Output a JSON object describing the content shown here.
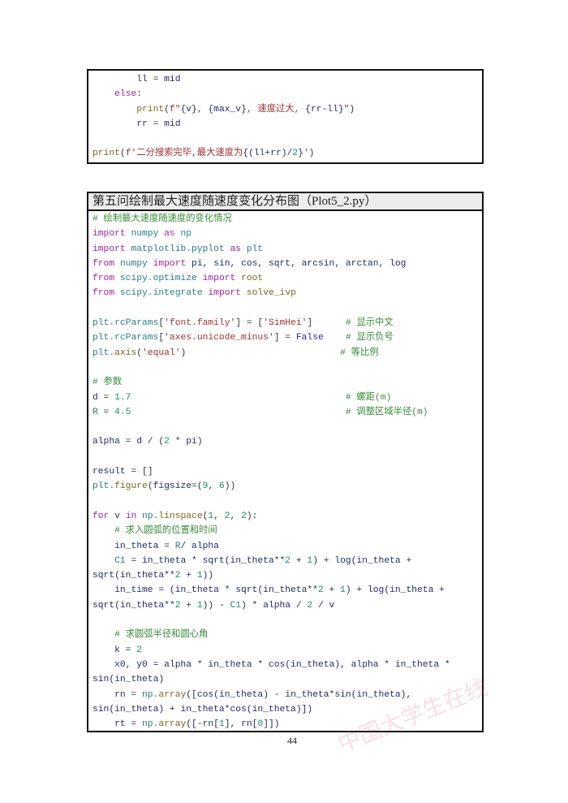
{
  "box1": {
    "lines": [
      [
        [
          "p",
          "        "
        ],
        [
          "v",
          "ll"
        ],
        [
          "p",
          " = "
        ],
        [
          "v",
          "mid"
        ]
      ],
      [
        [
          "p",
          "    "
        ],
        [
          "k",
          "else"
        ],
        [
          "p",
          ":"
        ]
      ],
      [
        [
          "p",
          "        "
        ],
        [
          "f",
          "print"
        ],
        [
          "p",
          "("
        ],
        [
          "s",
          "f\""
        ],
        [
          "v",
          "{v}"
        ],
        [
          "s",
          ", "
        ],
        [
          "v",
          "{max_v}"
        ],
        [
          "s",
          ", 速度过大, "
        ],
        [
          "v",
          "{rr-ll}"
        ],
        [
          "s",
          "\""
        ],
        [
          "p",
          ")"
        ]
      ],
      [
        [
          "p",
          "        "
        ],
        [
          "v",
          "rr"
        ],
        [
          "p",
          " = "
        ],
        [
          "v",
          "mid"
        ]
      ],
      [],
      [
        [
          "f",
          "print"
        ],
        [
          "p",
          "("
        ],
        [
          "s",
          "f'二分搜索完毕,最大速度为"
        ],
        [
          "v",
          "{(ll+rr)/"
        ],
        [
          "n",
          "2"
        ],
        [
          "v",
          "}"
        ],
        [
          "s",
          "'"
        ],
        [
          "p",
          ")"
        ]
      ]
    ]
  },
  "box2": {
    "title": "第五问绘制最大速度随速度变化分布图（Plot5_2.py）",
    "lines": [
      [
        [
          "c",
          "# 绘制最大速度随速度的变化情况"
        ]
      ],
      [
        [
          "k",
          "import"
        ],
        [
          "p",
          " "
        ],
        [
          "m",
          "numpy"
        ],
        [
          "p",
          " "
        ],
        [
          "k",
          "as"
        ],
        [
          "p",
          " "
        ],
        [
          "m",
          "np"
        ]
      ],
      [
        [
          "k",
          "import"
        ],
        [
          "p",
          " "
        ],
        [
          "m",
          "matplotlib.pyplot"
        ],
        [
          "p",
          " "
        ],
        [
          "k",
          "as"
        ],
        [
          "p",
          " "
        ],
        [
          "m",
          "plt"
        ]
      ],
      [
        [
          "k",
          "from"
        ],
        [
          "p",
          " "
        ],
        [
          "m",
          "numpy"
        ],
        [
          "p",
          " "
        ],
        [
          "k",
          "import"
        ],
        [
          "v",
          " pi, sin, cos, sqrt, arcsin, arctan, log"
        ]
      ],
      [
        [
          "k",
          "from"
        ],
        [
          "p",
          " "
        ],
        [
          "m",
          "scipy.optimize"
        ],
        [
          "p",
          " "
        ],
        [
          "k",
          "import"
        ],
        [
          "p",
          " "
        ],
        [
          "f",
          "root"
        ]
      ],
      [
        [
          "k",
          "from"
        ],
        [
          "p",
          " "
        ],
        [
          "m",
          "scipy.integrate"
        ],
        [
          "p",
          " "
        ],
        [
          "k",
          "import"
        ],
        [
          "p",
          " "
        ],
        [
          "f",
          "solve_ivp"
        ]
      ],
      [],
      [
        [
          "m",
          "plt.rcParams"
        ],
        [
          "p",
          "["
        ],
        [
          "s",
          "'font.family'"
        ],
        [
          "p",
          "] = ["
        ],
        [
          "s",
          "'SimHei'"
        ],
        [
          "p",
          "]      "
        ],
        [
          "c",
          "# 显示中文"
        ]
      ],
      [
        [
          "m",
          "plt.rcParams"
        ],
        [
          "p",
          "["
        ],
        [
          "s",
          "'axes.unicode_minus'"
        ],
        [
          "p",
          "] = "
        ],
        [
          "b",
          "False"
        ],
        [
          "p",
          "    "
        ],
        [
          "c",
          "# 显示负号"
        ]
      ],
      [
        [
          "m",
          "plt."
        ],
        [
          "f",
          "axis"
        ],
        [
          "p",
          "("
        ],
        [
          "s",
          "'equal'"
        ],
        [
          "p",
          ")                            "
        ],
        [
          "c",
          "# 等比例"
        ]
      ],
      [],
      [
        [
          "c",
          "# 参数"
        ]
      ],
      [
        [
          "v",
          "d"
        ],
        [
          "p",
          " = "
        ],
        [
          "n",
          "1.7"
        ],
        [
          "p",
          "                                       "
        ],
        [
          "c",
          "# 螺距(m)"
        ]
      ],
      [
        [
          "m",
          "R"
        ],
        [
          "p",
          " = "
        ],
        [
          "n",
          "4.5"
        ],
        [
          "p",
          "                                       "
        ],
        [
          "c",
          "# 调整区域半径(m)"
        ]
      ],
      [],
      [
        [
          "v",
          "alpha"
        ],
        [
          "p",
          " = "
        ],
        [
          "v",
          "d"
        ],
        [
          "p",
          " / ("
        ],
        [
          "n",
          "2"
        ],
        [
          "p",
          " * "
        ],
        [
          "v",
          "pi"
        ],
        [
          "p",
          ")"
        ]
      ],
      [],
      [
        [
          "v",
          "result"
        ],
        [
          "p",
          " = []"
        ]
      ],
      [
        [
          "m",
          "plt."
        ],
        [
          "f",
          "figure"
        ],
        [
          "p",
          "("
        ],
        [
          "v",
          "figsize"
        ],
        [
          "p",
          "=("
        ],
        [
          "n",
          "9"
        ],
        [
          "p",
          ", "
        ],
        [
          "n",
          "6"
        ],
        [
          "p",
          "))"
        ]
      ],
      [],
      [
        [
          "k",
          "for"
        ],
        [
          "v",
          " v "
        ],
        [
          "k",
          "in"
        ],
        [
          "p",
          " "
        ],
        [
          "m",
          "np."
        ],
        [
          "f",
          "linspace"
        ],
        [
          "p",
          "("
        ],
        [
          "n",
          "1"
        ],
        [
          "p",
          ", "
        ],
        [
          "n",
          "2"
        ],
        [
          "p",
          ", "
        ],
        [
          "n",
          "2"
        ],
        [
          "p",
          "):"
        ]
      ],
      [
        [
          "p",
          "    "
        ],
        [
          "c",
          "# 求入圆弧的位置和时间"
        ]
      ],
      [
        [
          "p",
          "    "
        ],
        [
          "v",
          "in_theta"
        ],
        [
          "p",
          " = "
        ],
        [
          "m",
          "R"
        ],
        [
          "v",
          "/ alpha"
        ]
      ],
      [
        [
          "p",
          "    "
        ],
        [
          "m",
          "C1"
        ],
        [
          "v",
          " = in_theta * sqrt(in_theta**"
        ],
        [
          "n",
          "2"
        ],
        [
          "v",
          " + "
        ],
        [
          "n",
          "1"
        ],
        [
          "v",
          ") + log(in_theta +"
        ]
      ],
      [
        [
          "v",
          "sqrt(in_theta**"
        ],
        [
          "n",
          "2"
        ],
        [
          "v",
          " + "
        ],
        [
          "n",
          "1"
        ],
        [
          "v",
          "))"
        ]
      ],
      [
        [
          "p",
          "    "
        ],
        [
          "v",
          "in_time = (in_theta * sqrt(in_theta**"
        ],
        [
          "n",
          "2"
        ],
        [
          "v",
          " + "
        ],
        [
          "n",
          "1"
        ],
        [
          "v",
          ") + log(in_theta +"
        ]
      ],
      [
        [
          "v",
          "sqrt(in_theta**"
        ],
        [
          "n",
          "2"
        ],
        [
          "v",
          " + "
        ],
        [
          "n",
          "1"
        ],
        [
          "v",
          ")) - "
        ],
        [
          "m",
          "C1"
        ],
        [
          "v",
          ") * alpha / "
        ],
        [
          "n",
          "2"
        ],
        [
          "v",
          " / v"
        ]
      ],
      [],
      [
        [
          "p",
          "    "
        ],
        [
          "c",
          "# 求圆弧半径和圆心角"
        ]
      ],
      [
        [
          "p",
          "    "
        ],
        [
          "v",
          "k = "
        ],
        [
          "n",
          "2"
        ]
      ],
      [
        [
          "p",
          "    "
        ],
        [
          "v",
          "x0, y0 = alpha * in_theta * cos(in_theta), alpha * in_theta *"
        ]
      ],
      [
        [
          "v",
          "sin(in_theta)"
        ]
      ],
      [
        [
          "p",
          "    "
        ],
        [
          "v",
          "rn = "
        ],
        [
          "m",
          "np."
        ],
        [
          "f",
          "array"
        ],
        [
          "v",
          "([cos(in_theta) - in_theta*sin(in_theta),"
        ]
      ],
      [
        [
          "v",
          "sin(in_theta) + in_theta*cos(in_theta)])"
        ]
      ],
      [
        [
          "p",
          "    "
        ],
        [
          "v",
          "rt = "
        ],
        [
          "m",
          "np."
        ],
        [
          "f",
          "array"
        ],
        [
          "v",
          "([-rn["
        ],
        [
          "n",
          "1"
        ],
        [
          "v",
          "], rn["
        ],
        [
          "n",
          "0"
        ],
        [
          "v",
          "]])"
        ]
      ]
    ]
  },
  "page_number": "44",
  "watermark": "中国大学生在线 dxs.moe.gov.cn"
}
